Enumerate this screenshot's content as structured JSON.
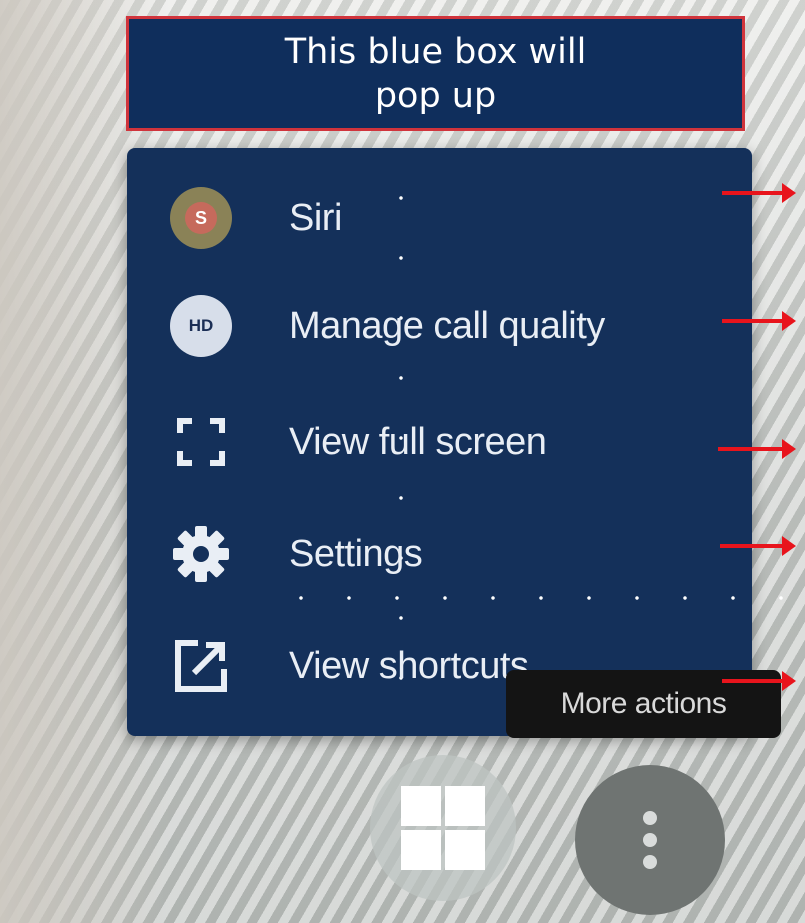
{
  "callout": {
    "text": "This blue box will pop up"
  },
  "menu": {
    "items": [
      {
        "label": "Siri",
        "icon": "avatar-s-icon",
        "avatar_letter": "S"
      },
      {
        "label": "Manage call quality",
        "icon": "hd-icon",
        "badge": "HD"
      },
      {
        "label": "View full screen",
        "icon": "fullscreen-icon"
      },
      {
        "label": "Settings",
        "icon": "gear-icon"
      },
      {
        "label": "View shortcuts",
        "icon": "external-link-icon"
      }
    ]
  },
  "tooltip": {
    "text": "More actions"
  },
  "bottom_buttons": [
    {
      "icon": "layout-grid-icon"
    },
    {
      "icon": "more-actions-icon"
    }
  ],
  "colors": {
    "menu_bg": "#14305a",
    "callout_bg": "#0f2e5c",
    "callout_border": "#d0343c",
    "arrow": "#e8141c",
    "tooltip_bg": "#141414"
  }
}
